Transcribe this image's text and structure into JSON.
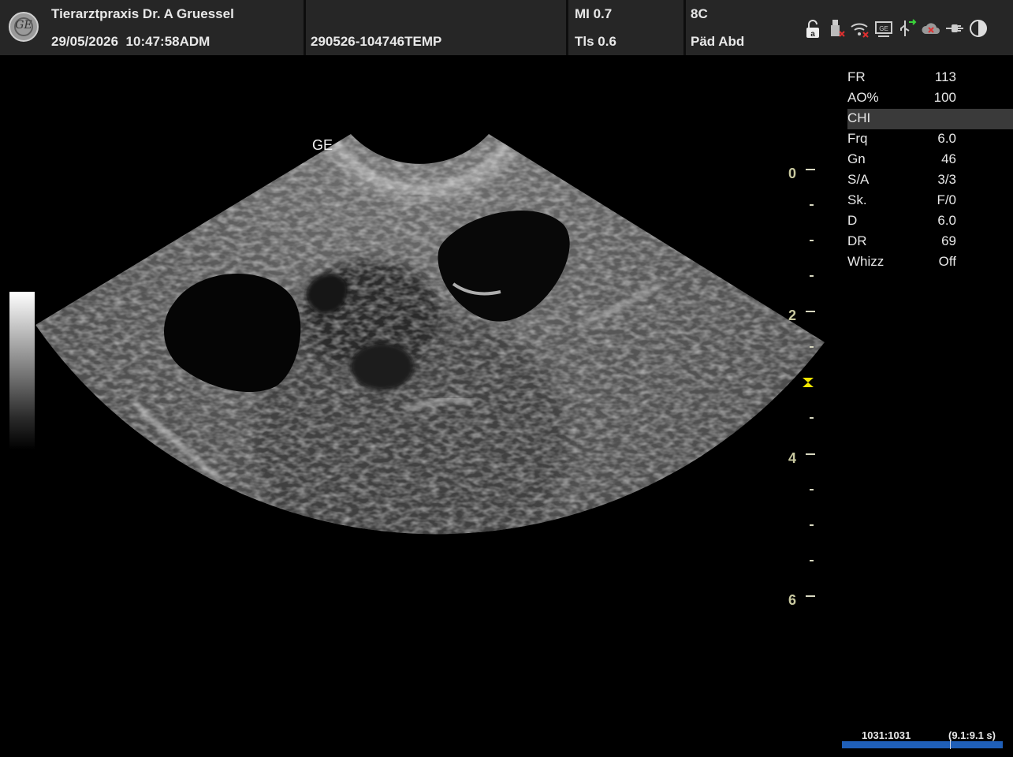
{
  "header": {
    "clinic": "Tierarztpraxis Dr. A Gruessel",
    "date": "29/05/2026",
    "time": "10:47:58",
    "operator": "ADM",
    "patient_id": "290526-104746TEMP",
    "mi": "MI 0.7",
    "tis": "Tls 0.6",
    "probe": "8C",
    "preset": "Päd Abd"
  },
  "status_icons": [
    "lock-icon",
    "usb-disconnected-icon",
    "wifi-disconnected-icon",
    "network-icon",
    "usb-transfer-icon",
    "cloud-disconnected-icon",
    "power-plug-icon",
    "brightness-contrast-icon"
  ],
  "image": {
    "orientation_mark": "GE",
    "depth_scale": [
      {
        "label": "0"
      },
      {
        "label": "2"
      },
      {
        "label": "4"
      },
      {
        "label": "6"
      }
    ]
  },
  "parameters": [
    {
      "key": "FR",
      "value": "113"
    },
    {
      "key": "AO%",
      "value": "100"
    },
    {
      "key": "CHI",
      "value": "",
      "highlight": true
    },
    {
      "key": "Frq",
      "value": "6.0"
    },
    {
      "key": "Gn",
      "value": "46"
    },
    {
      "key": "S/A",
      "value": "3/3"
    },
    {
      "key": "Sk.",
      "value": "F/0"
    },
    {
      "key": "D",
      "value": "6.0"
    },
    {
      "key": "DR",
      "value": "69"
    },
    {
      "key": "Whizz",
      "value": "Off"
    }
  ],
  "cine": {
    "frames": "1031:1031",
    "duration": "(9.1:9.1 s)"
  },
  "colors": {
    "header_bg": "#262626",
    "depth_marker": "#c9c9a0",
    "focus_marker": "#f2e600",
    "cine_bar": "#1f5fb8"
  }
}
